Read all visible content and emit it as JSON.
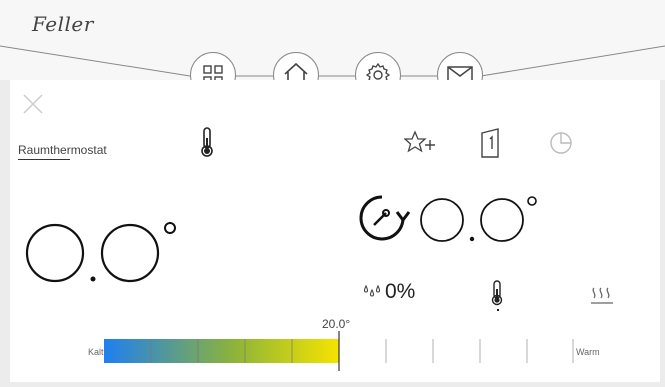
{
  "app": {
    "logo_text": "Feller"
  },
  "nav": [
    {
      "name": "grid-icon"
    },
    {
      "name": "home-icon"
    },
    {
      "name": "gear-icon"
    },
    {
      "name": "mail-icon"
    }
  ],
  "thermostat": {
    "room_label": "Raumthermostat",
    "current_temp_display": "○.○°",
    "setpoint_temp_display": "○.○°",
    "humidity": "0%",
    "setpoint_value": "20.0°",
    "scale_left": "Kalt",
    "scale_right": "Warm",
    "scale_fill_fraction": 0.5
  },
  "icons": {
    "thermometer": "thermometer-icon",
    "favorite_add": "favorite-add-icon",
    "door": "door-icon",
    "timer": "timer-icon",
    "mode": "mode-dial-icon",
    "humidity": "humidity-icon",
    "heating": "heating-icon"
  },
  "colors": {
    "bar_start": "#1e7ff0",
    "bar_mid": "#8cb33a",
    "bar_end": "#f5e400"
  }
}
